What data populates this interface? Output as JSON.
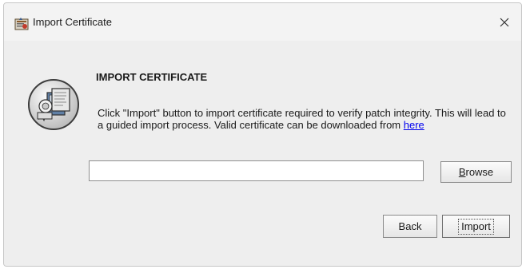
{
  "window": {
    "title": "Import Certificate",
    "icons": {
      "app": "certificate-app-icon",
      "close": "close-icon",
      "illustration": "certificate-illustration-icon"
    }
  },
  "content": {
    "heading": "IMPORT CERTIFICATE",
    "description_text": "Click \"Import\" button to import certificate required to verify patch integrity. This will lead to a guided import process. Valid certificate can be downloaded from ",
    "link_text": "here"
  },
  "file_input": {
    "value": "",
    "placeholder": ""
  },
  "buttons": {
    "browse_mnemonic": "B",
    "browse_rest": "rowse",
    "back": "Back",
    "import": "Import"
  },
  "colors": {
    "window_bg": "#eeeeee",
    "titlebar_bg": "#f3f3f3",
    "link": "#0000ee",
    "text": "#1a1a1a"
  }
}
